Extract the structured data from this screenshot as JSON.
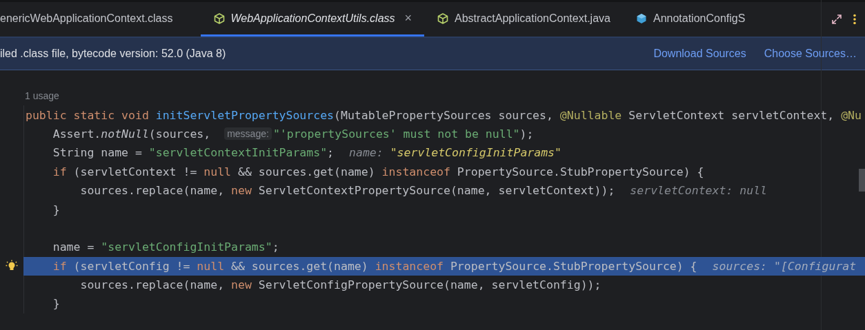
{
  "tabs": [
    {
      "label": "enericWebApplicationContext.class",
      "selected": false,
      "kind": "plain"
    },
    {
      "label": "WebApplicationContextUtils.class",
      "selected": true,
      "kind": "outline",
      "close": "×"
    },
    {
      "label": "AbstractApplicationContext.java",
      "selected": false,
      "kind": "outline"
    },
    {
      "label": "AnnotationConfigS",
      "selected": false,
      "kind": "filled"
    }
  ],
  "banner": {
    "text": "iled .class file, bytecode version: 52.0 (Java 8)",
    "links": [
      "Download Sources",
      "Choose Sources…"
    ]
  },
  "editor": {
    "usage_hint": "1 usage",
    "lines": [
      {
        "current": false,
        "bulb": false,
        "tokens": [
          {
            "kind": "keyword",
            "text": "public static void "
          },
          {
            "kind": "method",
            "text": "initServletPropertySources"
          },
          {
            "kind": "plain",
            "text": "(MutablePropertySources sources, "
          },
          {
            "kind": "annotation",
            "text": "@Nullable"
          },
          {
            "kind": "plain",
            "text": " ServletContext servletContext, "
          },
          {
            "kind": "annotation",
            "text": "@Nu"
          }
        ]
      },
      {
        "current": false,
        "bulb": false,
        "tokens": [
          {
            "kind": "plain",
            "text": "    Assert."
          },
          {
            "kind": "italic",
            "text": "notNull"
          },
          {
            "kind": "plain",
            "text": "(sources, "
          },
          {
            "kind": "hint",
            "text": "message:"
          },
          {
            "kind": "string",
            "text": "\"'propertySources' must not be null\""
          },
          {
            "kind": "plain",
            "text": ");"
          }
        ]
      },
      {
        "current": false,
        "bulb": false,
        "tokens": [
          {
            "kind": "plain",
            "text": "    String name = "
          },
          {
            "kind": "string",
            "text": "\"servletContextInitParams\""
          },
          {
            "kind": "plain",
            "text": ";"
          },
          {
            "kind": "debug",
            "text": "name:",
            "value": "\"servletConfigInitParams\"",
            "changed": true
          }
        ]
      },
      {
        "current": false,
        "bulb": false,
        "tokens": [
          {
            "kind": "keyword",
            "text": "    if"
          },
          {
            "kind": "plain",
            "text": " (servletContext != "
          },
          {
            "kind": "keyword",
            "text": "null"
          },
          {
            "kind": "plain",
            "text": " && sources.get(name) "
          },
          {
            "kind": "keyword",
            "text": "instanceof"
          },
          {
            "kind": "plain",
            "text": " PropertySource.StubPropertySource) {"
          }
        ]
      },
      {
        "current": false,
        "bulb": false,
        "tokens": [
          {
            "kind": "plain",
            "text": "        sources.replace(name, "
          },
          {
            "kind": "keyword",
            "text": "new"
          },
          {
            "kind": "plain",
            "text": " ServletContextPropertySource(name, servletContext));"
          },
          {
            "kind": "debug",
            "text": "servletContext:",
            "value": "null",
            "changed": false
          }
        ]
      },
      {
        "current": false,
        "bulb": false,
        "tokens": [
          {
            "kind": "plain",
            "text": "    }"
          }
        ]
      },
      {
        "current": false,
        "bulb": false
      },
      {
        "current": false,
        "bulb": false,
        "tokens": [
          {
            "kind": "plain",
            "text": "    name = "
          },
          {
            "kind": "string",
            "text": "\"servletConfigInitParams\""
          },
          {
            "kind": "plain",
            "text": ";"
          }
        ]
      },
      {
        "current": true,
        "bulb": true,
        "tokens": [
          {
            "kind": "keyword",
            "text": "    if"
          },
          {
            "kind": "plain",
            "text": " (servletConfig != "
          },
          {
            "kind": "keyword",
            "text": "null"
          },
          {
            "kind": "plain",
            "text": " && sources.get(name) "
          },
          {
            "kind": "keyword",
            "text": "instanceof"
          },
          {
            "kind": "plain",
            "text": " PropertySource.StubPropertySource) {"
          },
          {
            "kind": "debug",
            "text": "sources:",
            "value": "\"[Configurat",
            "changed": false
          }
        ]
      },
      {
        "current": false,
        "bulb": false,
        "tokens": [
          {
            "kind": "plain",
            "text": "        sources.replace(name, "
          },
          {
            "kind": "keyword",
            "text": "new"
          },
          {
            "kind": "plain",
            "text": " ServletConfigPropertySource(name, servletConfig));"
          }
        ]
      },
      {
        "current": false,
        "bulb": false,
        "tokens": [
          {
            "kind": "plain",
            "text": "    }"
          }
        ]
      }
    ]
  }
}
